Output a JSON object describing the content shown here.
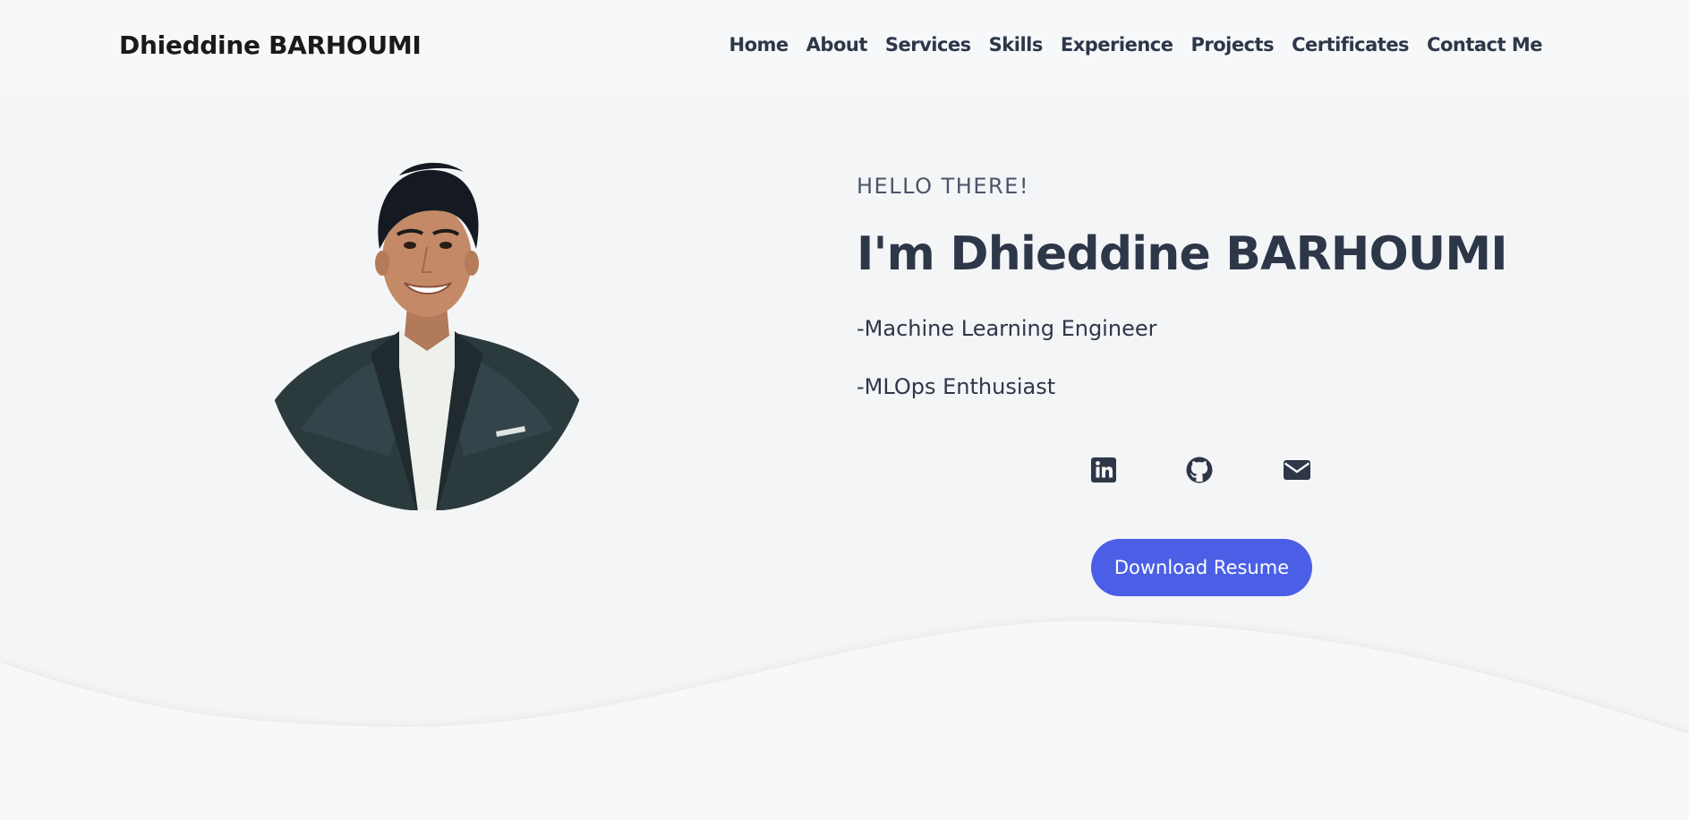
{
  "header": {
    "brand": "Dhieddine BARHOUMI",
    "nav": [
      {
        "label": "Home"
      },
      {
        "label": "About"
      },
      {
        "label": "Services"
      },
      {
        "label": "Skills"
      },
      {
        "label": "Experience"
      },
      {
        "label": "Projects"
      },
      {
        "label": "Certificates"
      },
      {
        "label": "Contact Me"
      }
    ]
  },
  "hero": {
    "greeting": "HELLO THERE!",
    "title": "I'm Dhieddine BARHOUMI",
    "roles": [
      "-Machine Learning Engineer",
      "-MLOps Enthusiast"
    ],
    "social": [
      {
        "icon": "linkedin-icon"
      },
      {
        "icon": "github-icon"
      },
      {
        "icon": "envelope-icon"
      }
    ],
    "cta_label": "Download Resume",
    "portrait": {
      "subject": "smiling man in dark suit jacket and white shirt"
    }
  },
  "colors": {
    "accent": "#4b5fe6",
    "text_dark": "#2d3748",
    "background": "#f4f5f7",
    "navbar_bg": "#f6f8fa"
  }
}
